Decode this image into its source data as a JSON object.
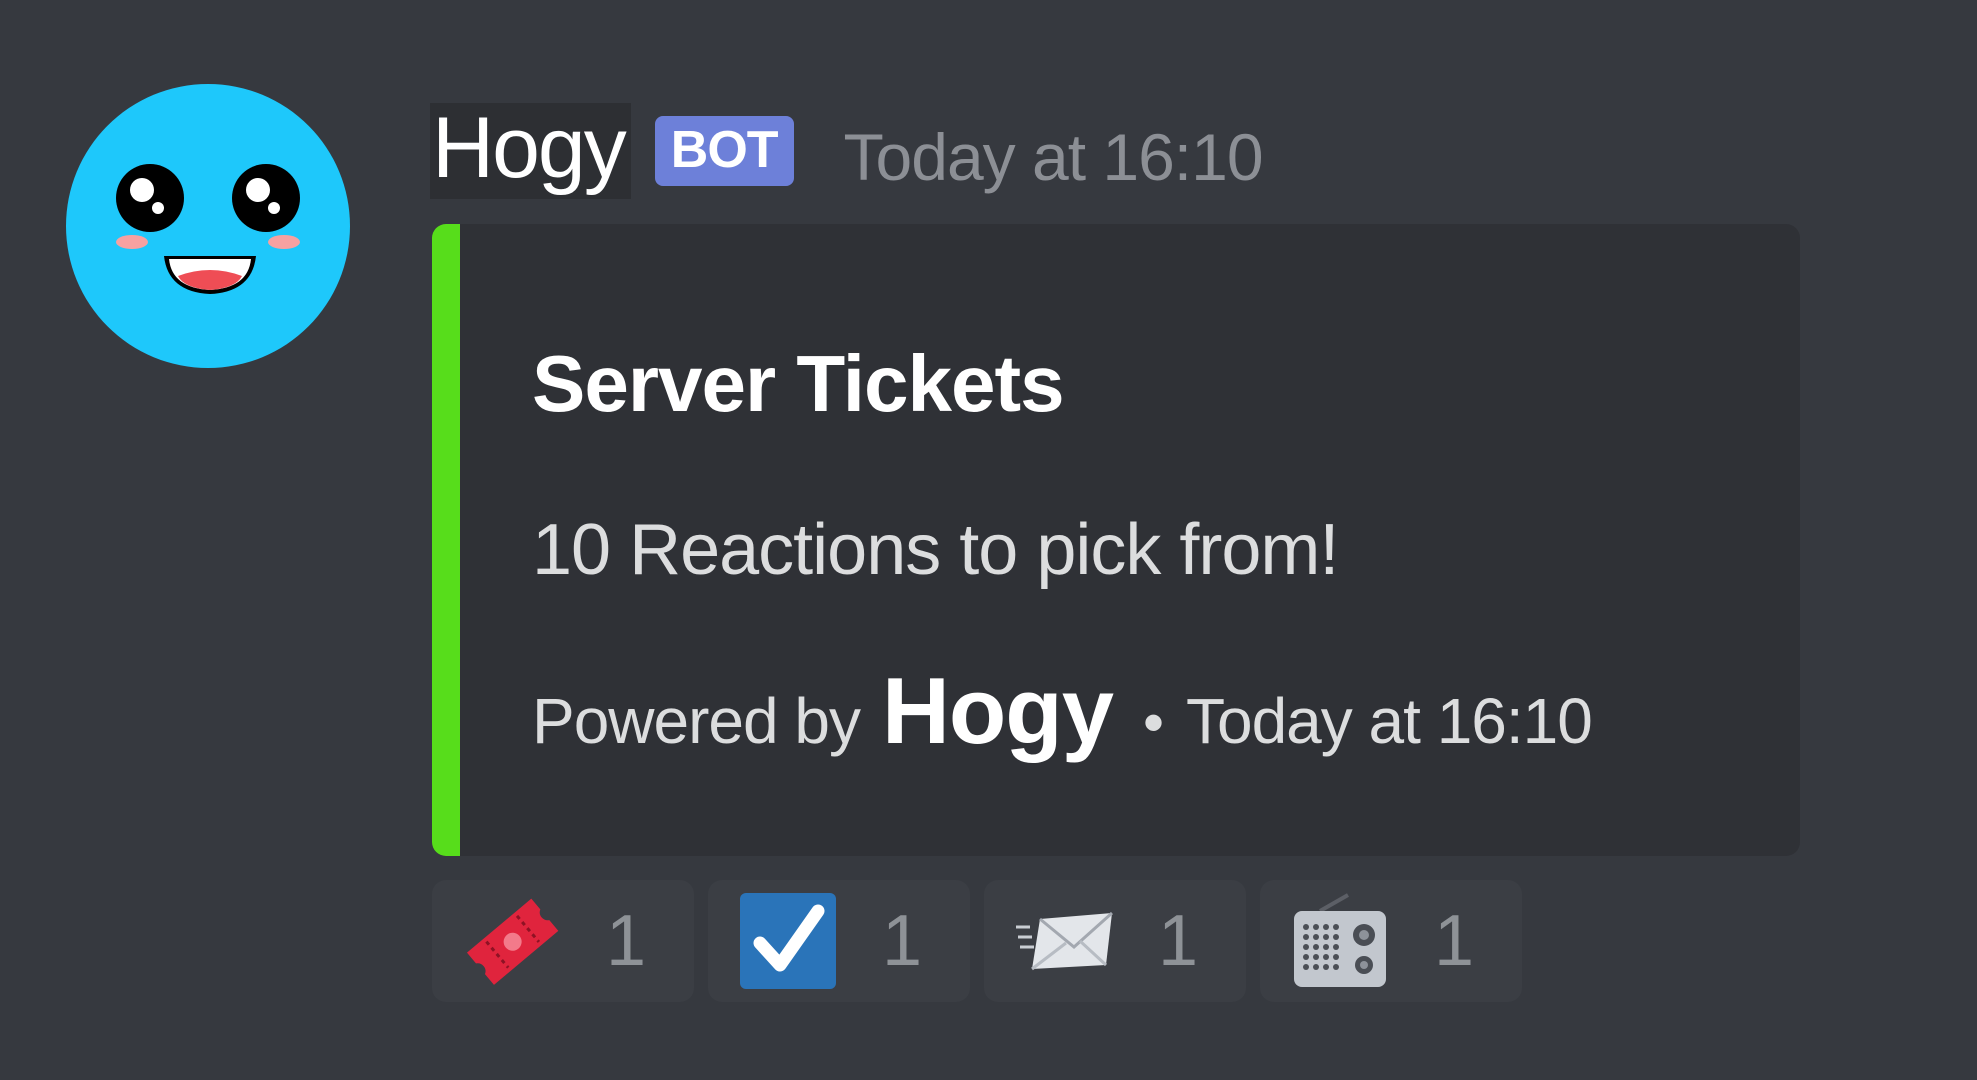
{
  "author": {
    "name": "Hogy",
    "badge": "BOT",
    "timestamp": "Today at 16:10",
    "avatar_icon": "smiley-face-avatar"
  },
  "embed": {
    "accent_color": "#57dd1b",
    "title": "Server Tickets",
    "description": "10 Reactions to pick from!",
    "footer": {
      "text": "Powered by",
      "name": "Hogy",
      "separator": "•",
      "timestamp": "Today at 16:10"
    }
  },
  "reactions": [
    {
      "emoji": "ticket-icon",
      "count": "1"
    },
    {
      "emoji": "check-box-icon",
      "count": "1"
    },
    {
      "emoji": "incoming-envelope-icon",
      "count": "1"
    },
    {
      "emoji": "radio-icon",
      "count": "1"
    }
  ]
}
